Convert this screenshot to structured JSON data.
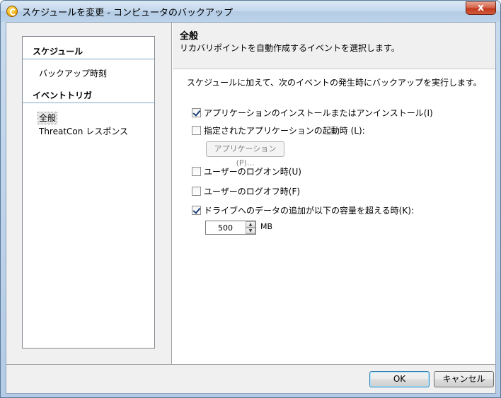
{
  "window": {
    "title": "スケジュールを変更 - コンピュータのバックアップ",
    "close_glyph": "x"
  },
  "nav": {
    "sections": [
      {
        "heading": "スケジュール",
        "items": [
          "バックアップ時刻"
        ]
      },
      {
        "heading": "イベントトリガ",
        "items": [
          "全般",
          "ThreatCon レスポンス"
        ]
      }
    ],
    "selected_item": "全般"
  },
  "panel": {
    "title": "全般",
    "subtitle": "リカバリポイントを自動作成するイベントを選択します。",
    "intro": "スケジュールに加えて、次のイベントの発生時にバックアップを実行します。",
    "options": [
      {
        "label": "アプリケーションのインストールまたはアンインストール(I)",
        "checked": true
      },
      {
        "label": "指定されたアプリケーションの起動時 (L):",
        "checked": false
      },
      {
        "label": "ユーザーのログオン時(U)",
        "checked": false
      },
      {
        "label": "ユーザーのログオフ時(F)",
        "checked": false
      },
      {
        "label": "ドライブへのデータの追加が以下の容量を超える時(K):",
        "checked": true
      }
    ],
    "applications_button": "アプリケーション(P)...",
    "size_value": "500",
    "size_unit": "MB"
  },
  "footer": {
    "ok_label": "OK",
    "cancel_label": "キャンセル"
  }
}
